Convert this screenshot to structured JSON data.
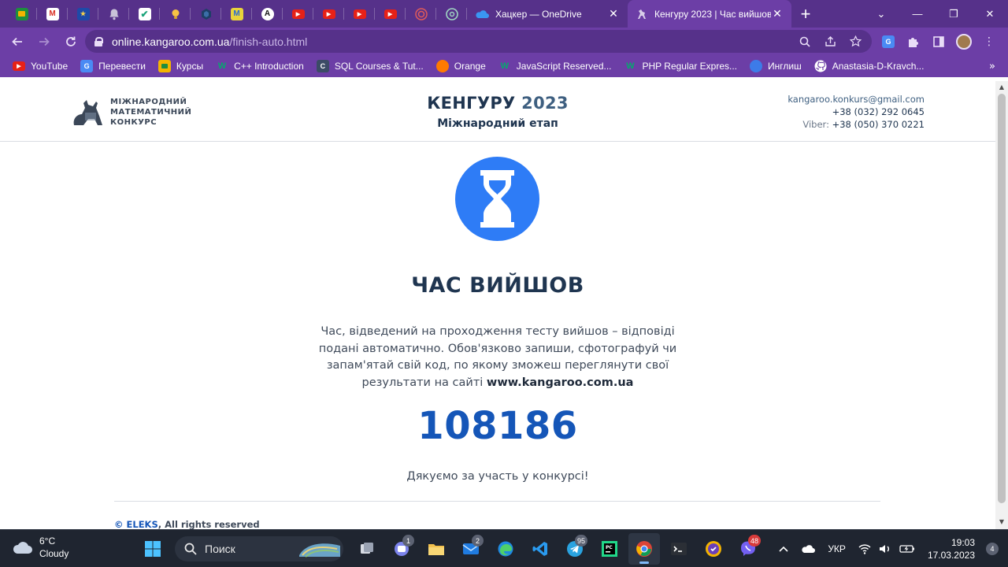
{
  "browser": {
    "pinned_tabs": [
      {
        "icon": "google-classroom-icon",
        "color": "#f4b400",
        "glyph": ""
      },
      {
        "icon": "gmail-icon",
        "color": "#ffffff",
        "glyph": "M"
      },
      {
        "icon": "eu-flag-icon",
        "color": "#1e4aa8",
        "glyph": ""
      },
      {
        "icon": "bell-icon",
        "color": "#b8b8c8",
        "glyph": ""
      },
      {
        "icon": "checkmark-app-icon",
        "color": "#1aa37a",
        "glyph": ""
      },
      {
        "icon": "lightbulb-icon",
        "color": "#f6c244",
        "glyph": ""
      },
      {
        "icon": "hexagon-app-icon",
        "color": "#23466e",
        "glyph": ""
      },
      {
        "icon": "m-logo-icon",
        "color": "#e8d23b",
        "glyph": "M"
      },
      {
        "icon": "letter-a-icon",
        "color": "#111111",
        "glyph": "A"
      },
      {
        "icon": "youtube-icon",
        "color": "#e62117",
        "glyph": ""
      },
      {
        "icon": "youtube-icon",
        "color": "#e62117",
        "glyph": ""
      },
      {
        "icon": "youtube-icon",
        "color": "#e62117",
        "glyph": ""
      },
      {
        "icon": "youtube-icon",
        "color": "#e62117",
        "glyph": ""
      },
      {
        "icon": "target-app-icon",
        "color": "#c94b4b",
        "glyph": ""
      },
      {
        "icon": "chatgpt-icon",
        "color": "#7dbfa8",
        "glyph": ""
      }
    ],
    "tabs": [
      {
        "title": "Хацкер — OneDrive",
        "icon": "onedrive-icon",
        "active": false
      },
      {
        "title": "Кенгуру 2023 | Час вийшов",
        "icon": "kangaroo-icon",
        "active": true
      }
    ],
    "new_tab_label": "+",
    "window_controls": {
      "menu": "⌄",
      "minimize": "—",
      "restore": "❐",
      "close": "✕"
    },
    "address": {
      "domain": "online.kangaroo.com.ua",
      "path": "/finish-auto.html"
    },
    "bookmarks": [
      {
        "label": "YouTube",
        "icon": "youtube-icon",
        "color": "#e62117"
      },
      {
        "label": "Перевести",
        "icon": "google-translate-icon",
        "color": "#4a8af4"
      },
      {
        "label": "Курсы",
        "icon": "google-classroom-icon",
        "color": "#f4b400"
      },
      {
        "label": "C++ Introduction",
        "icon": "w3schools-icon",
        "color": "#04aa6d"
      },
      {
        "label": "SQL Courses & Tut...",
        "icon": "sql-course-icon",
        "color": "#3b4b66"
      },
      {
        "label": "Orange",
        "icon": "orange-icon",
        "color": "#ff7a00"
      },
      {
        "label": "JavaScript Reserved...",
        "icon": "w3schools-icon",
        "color": "#04aa6d"
      },
      {
        "label": "PHP Regular Expres...",
        "icon": "w3schools-icon",
        "color": "#04aa6d"
      },
      {
        "label": "Инглиш",
        "icon": "english-app-icon",
        "color": "#3d7be8"
      },
      {
        "label": "Anastasia-D-Kravch...",
        "icon": "github-icon",
        "color": "#ffffff"
      }
    ],
    "bookmarks_more": "»"
  },
  "site": {
    "logo_lines": [
      "МІЖНАРОДНИЙ",
      "МАТЕМАТИЧНИЙ",
      "КОНКУРС"
    ],
    "event_title": "КЕНГУРУ",
    "event_year": "2023",
    "event_subtitle": "Міжнародний етап",
    "contacts": {
      "email": "kangaroo.konkurs@gmail.com",
      "phone": "+38 (032) 292 0645",
      "viber_label": "Viber:",
      "viber_phone": "+38 (050) 370 0221"
    },
    "accent_color": "#2e7cf6",
    "title": "ЧАС ВИЙШОВ",
    "description": "Час, відведений на проходження тесту вийшов – відповіді подані автоматично. Обов'язково запиши, сфотографуй чи запам'ятай свій код, по якому зможеш переглянути свої результати на сайті",
    "description_site": "www.kangaroo.com.ua",
    "code": "108186",
    "thanks": "Дякуємо за участь у конкурсі!",
    "copyright_symbol": "©",
    "copyright_brand": "ELEKS",
    "copyright_rest": ", All rights reserved"
  },
  "taskbar": {
    "weather": {
      "temp": "6°C",
      "condition": "Cloudy"
    },
    "search_label": "Поиск",
    "apps": [
      {
        "name": "task-view",
        "badge": ""
      },
      {
        "name": "teams-chat",
        "badge": "1"
      },
      {
        "name": "file-explorer",
        "badge": ""
      },
      {
        "name": "mail",
        "badge": "2"
      },
      {
        "name": "edge",
        "badge": ""
      },
      {
        "name": "vscode",
        "badge": ""
      },
      {
        "name": "telegram",
        "badge": "95"
      },
      {
        "name": "pycharm",
        "badge": ""
      },
      {
        "name": "chrome",
        "badge": ""
      },
      {
        "name": "terminal",
        "badge": ""
      },
      {
        "name": "vpn",
        "badge": ""
      },
      {
        "name": "viber",
        "badge": "48"
      }
    ],
    "language": "УКР",
    "time": "19:03",
    "date": "17.03.2023",
    "notifications": "4"
  }
}
